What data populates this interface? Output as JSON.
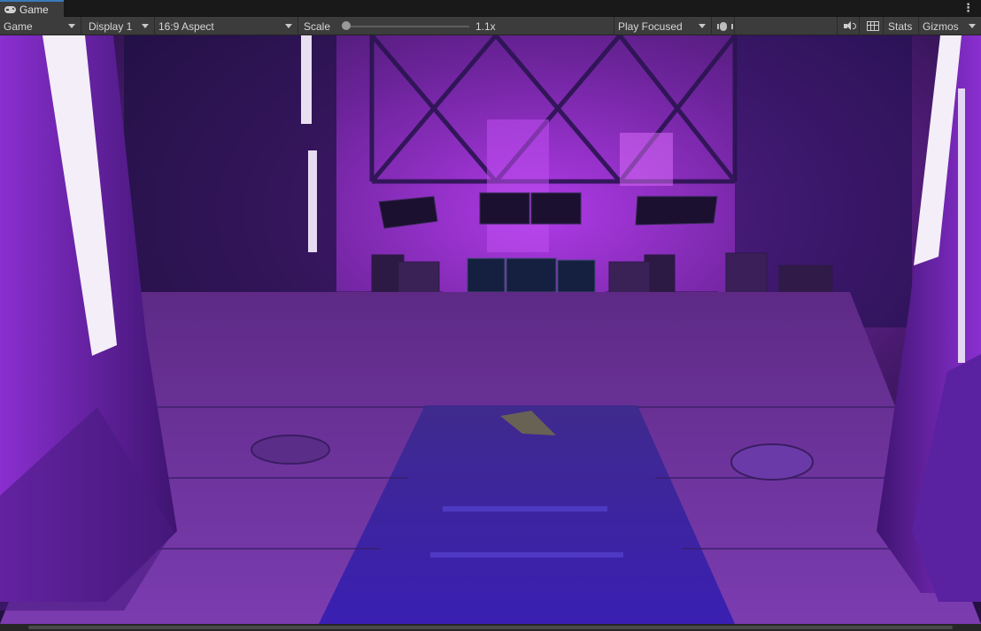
{
  "tab": {
    "title": "Game",
    "icon": "gamepad-icon"
  },
  "toolbar": {
    "view_mode": "Game",
    "display": "Display 1",
    "aspect": "16:9 Aspect",
    "scale_label": "Scale",
    "scale_value": "1.1x",
    "play_mode": "Play Focused",
    "stats_label": "Stats",
    "gizmos_label": "Gizmos"
  },
  "colors": {
    "toolbar_bg": "#3c3c3c",
    "tab_accent": "#3a79bb",
    "neon_purple": "#c23cf0",
    "floor_blue": "#3a1fa8"
  }
}
